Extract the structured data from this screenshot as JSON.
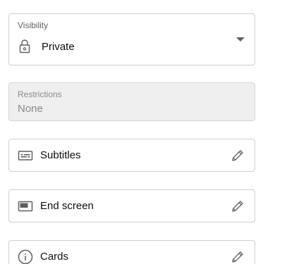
{
  "visibility": {
    "label": "Visibility",
    "value": "Private",
    "icon": "lock-icon"
  },
  "restrictions": {
    "label": "Restrictions",
    "value": "None"
  },
  "features": [
    {
      "label": "Subtitles",
      "icon": "subtitles-icon"
    },
    {
      "label": "End screen",
      "icon": "end-screen-icon"
    },
    {
      "label": "Cards",
      "icon": "info-icon"
    }
  ],
  "colors": {
    "border": "#cfcfcf",
    "disabled_bg": "#efefef",
    "secondary_text": "#606060",
    "disabled_text": "#8a8a8a",
    "icon": "#606060"
  }
}
